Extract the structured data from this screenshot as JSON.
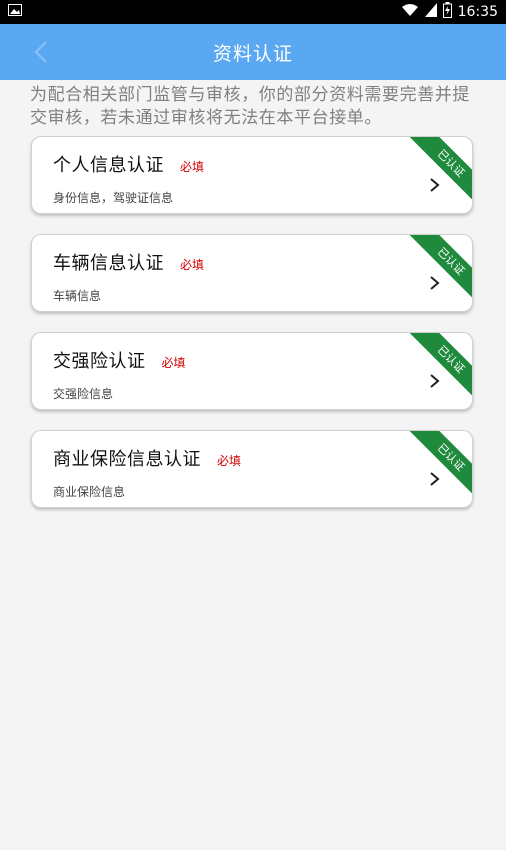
{
  "status_bar": {
    "time": "16:35"
  },
  "header": {
    "title": "资料认证"
  },
  "notice": "为配合相关部门监管与审核，你的部分资料需要完善并提交审核，若未通过审核将无法在本平台接单。",
  "cards": [
    {
      "title": "个人信息认证",
      "required": "必填",
      "subtitle": "身份信息，驾驶证信息",
      "badge": "已认证"
    },
    {
      "title": "车辆信息认证",
      "required": "必填",
      "subtitle": "车辆信息",
      "badge": "已认证"
    },
    {
      "title": "交强险认证",
      "required": "必填",
      "subtitle": "交强险信息",
      "badge": "已认证"
    },
    {
      "title": "商业保险信息认证",
      "required": "必填",
      "subtitle": "商业保险信息",
      "badge": "已认证"
    }
  ],
  "colors": {
    "header": "#5aa7f2",
    "ribbon": "#1f8a3c",
    "required": "#d40000"
  }
}
